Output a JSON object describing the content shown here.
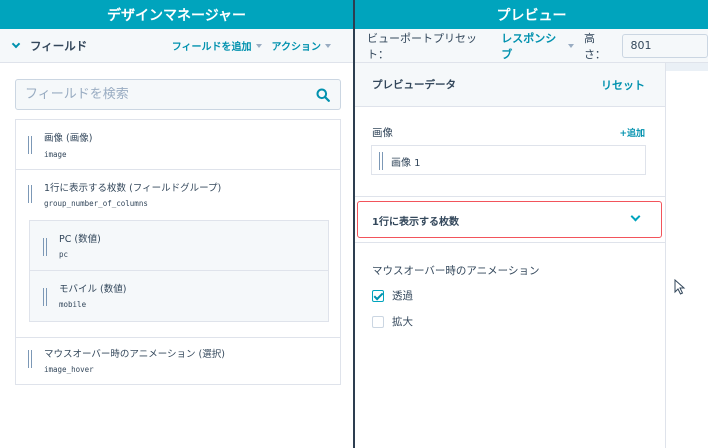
{
  "left_panel": {
    "title": "デザインマネージャー",
    "toolbar": {
      "fields_title": "フィールド",
      "add_field": "フィールドを追加",
      "actions": "アクション"
    },
    "search": {
      "placeholder": "フィールドを検索",
      "value": ""
    },
    "fields": [
      {
        "label": "画像 (画像)",
        "name": "image"
      },
      {
        "label": "1行に表示する枚数 (フィールドグループ)",
        "name": "group_number_of_columns",
        "children": [
          {
            "label": "PC (数値)",
            "name": "pc"
          },
          {
            "label": "モバイル (数値)",
            "name": "mobile"
          }
        ]
      },
      {
        "label": "マウスオーバー時のアニメーション (選択)",
        "name": "image_hover"
      }
    ]
  },
  "right_panel": {
    "title": "プレビュー",
    "toolbar": {
      "viewport_label": "ビューポートプリセット：",
      "viewport_value": "レスポンシブ",
      "height_label": "高さ：",
      "height_value": "801"
    },
    "preview_data": {
      "title": "プレビューデータ",
      "reset": "リセット",
      "image_section": {
        "label": "画像",
        "add": "+追加",
        "items": [
          {
            "label": "画像 1"
          }
        ]
      },
      "group_section": {
        "label": "1行に表示する枚数",
        "expanded": false
      },
      "hover_section": {
        "label": "マウスオーバー時のアニメーション",
        "options": [
          {
            "label": "透過",
            "checked": true
          },
          {
            "label": "拡大",
            "checked": false
          }
        ]
      }
    }
  },
  "colors": {
    "accent": "#00a4bd",
    "link": "#0091ae",
    "text": "#33475b",
    "border": "#dfe3eb",
    "subtle_bg": "#f5f8fa",
    "focus_border": "#f2545b",
    "divider": "#2d3e50"
  }
}
